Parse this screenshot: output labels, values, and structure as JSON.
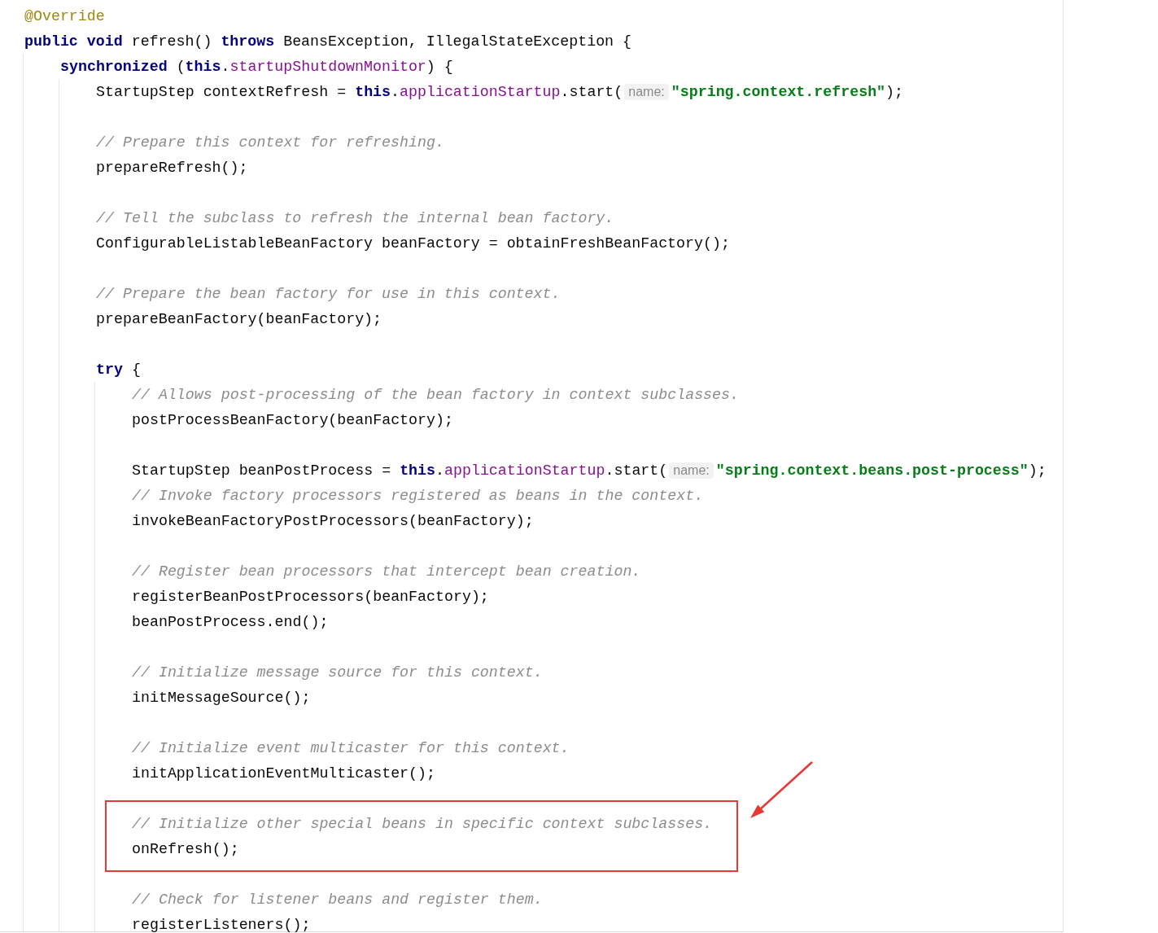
{
  "editor": {
    "lines": [
      {
        "kind": "code",
        "tokens": [
          {
            "kind": "annotation",
            "text": "@Override"
          }
        ]
      },
      {
        "kind": "code",
        "tokens": [
          {
            "kind": "keyword",
            "text": "public void"
          },
          {
            "kind": "plain",
            "text": " refresh() "
          },
          {
            "kind": "keyword",
            "text": "throws"
          },
          {
            "kind": "plain",
            "text": " BeansException, IllegalStateException {"
          }
        ],
        "children": [
          {
            "kind": "code",
            "tokens": [
              {
                "kind": "keyword",
                "text": "synchronized"
              },
              {
                "kind": "plain",
                "text": " ("
              },
              {
                "kind": "keyword",
                "text": "this"
              },
              {
                "kind": "plain",
                "text": "."
              },
              {
                "kind": "field",
                "text": "startupShutdownMonitor"
              },
              {
                "kind": "plain",
                "text": ") {"
              }
            ],
            "children": [
              {
                "kind": "code",
                "tokens": [
                  {
                    "kind": "plain",
                    "text": "StartupStep contextRefresh = "
                  },
                  {
                    "kind": "keyword",
                    "text": "this"
                  },
                  {
                    "kind": "plain",
                    "text": "."
                  },
                  {
                    "kind": "field",
                    "text": "applicationStartup"
                  },
                  {
                    "kind": "plain",
                    "text": ".start("
                  },
                  {
                    "kind": "hint",
                    "text": "name:"
                  },
                  {
                    "kind": "string",
                    "text": "\"spring.context.refresh\""
                  },
                  {
                    "kind": "plain",
                    "text": ");"
                  }
                ]
              },
              {
                "kind": "blank"
              },
              {
                "kind": "code",
                "tokens": [
                  {
                    "kind": "comment",
                    "text": "// Prepare this context for refreshing."
                  }
                ]
              },
              {
                "kind": "code",
                "tokens": [
                  {
                    "kind": "plain",
                    "text": "prepareRefresh();"
                  }
                ]
              },
              {
                "kind": "blank"
              },
              {
                "kind": "code",
                "tokens": [
                  {
                    "kind": "comment",
                    "text": "// Tell the subclass to refresh the internal bean factory."
                  }
                ]
              },
              {
                "kind": "code",
                "tokens": [
                  {
                    "kind": "plain",
                    "text": "ConfigurableListableBeanFactory beanFactory = obtainFreshBeanFactory();"
                  }
                ]
              },
              {
                "kind": "blank"
              },
              {
                "kind": "code",
                "tokens": [
                  {
                    "kind": "comment",
                    "text": "// Prepare the bean factory for use in this context."
                  }
                ]
              },
              {
                "kind": "code",
                "tokens": [
                  {
                    "kind": "plain",
                    "text": "prepareBeanFactory(beanFactory);"
                  }
                ]
              },
              {
                "kind": "blank"
              },
              {
                "kind": "code",
                "tokens": [
                  {
                    "kind": "keyword",
                    "text": "try"
                  },
                  {
                    "kind": "plain",
                    "text": " {"
                  }
                ],
                "children": [
                  {
                    "kind": "code",
                    "tokens": [
                      {
                        "kind": "comment",
                        "text": "// Allows post-processing of the bean factory in context subclasses."
                      }
                    ]
                  },
                  {
                    "kind": "code",
                    "tokens": [
                      {
                        "kind": "plain",
                        "text": "postProcessBeanFactory(beanFactory);"
                      }
                    ]
                  },
                  {
                    "kind": "blank"
                  },
                  {
                    "kind": "code",
                    "tokens": [
                      {
                        "kind": "plain",
                        "text": "StartupStep beanPostProcess = "
                      },
                      {
                        "kind": "keyword",
                        "text": "this"
                      },
                      {
                        "kind": "plain",
                        "text": "."
                      },
                      {
                        "kind": "field",
                        "text": "applicationStartup"
                      },
                      {
                        "kind": "plain",
                        "text": ".start("
                      },
                      {
                        "kind": "hint",
                        "text": "name:"
                      },
                      {
                        "kind": "string",
                        "text": "\"spring.context.beans.post-process\""
                      },
                      {
                        "kind": "plain",
                        "text": ");"
                      }
                    ]
                  },
                  {
                    "kind": "code",
                    "tokens": [
                      {
                        "kind": "comment",
                        "text": "// Invoke factory processors registered as beans in the context."
                      }
                    ]
                  },
                  {
                    "kind": "code",
                    "tokens": [
                      {
                        "kind": "plain",
                        "text": "invokeBeanFactoryPostProcessors(beanFactory);"
                      }
                    ]
                  },
                  {
                    "kind": "blank"
                  },
                  {
                    "kind": "code",
                    "tokens": [
                      {
                        "kind": "comment",
                        "text": "// Register bean processors that intercept bean creation."
                      }
                    ]
                  },
                  {
                    "kind": "code",
                    "tokens": [
                      {
                        "kind": "plain",
                        "text": "registerBeanPostProcessors(beanFactory);"
                      }
                    ]
                  },
                  {
                    "kind": "code",
                    "tokens": [
                      {
                        "kind": "plain",
                        "text": "beanPostProcess.end();"
                      }
                    ]
                  },
                  {
                    "kind": "blank"
                  },
                  {
                    "kind": "code",
                    "tokens": [
                      {
                        "kind": "comment",
                        "text": "// Initialize message source for this context."
                      }
                    ]
                  },
                  {
                    "kind": "code",
                    "tokens": [
                      {
                        "kind": "plain",
                        "text": "initMessageSource();"
                      }
                    ]
                  },
                  {
                    "kind": "blank"
                  },
                  {
                    "kind": "code",
                    "tokens": [
                      {
                        "kind": "comment",
                        "text": "// Initialize event multicaster for this context."
                      }
                    ]
                  },
                  {
                    "kind": "code",
                    "tokens": [
                      {
                        "kind": "plain",
                        "text": "initApplicationEventMulticaster();"
                      }
                    ]
                  },
                  {
                    "kind": "blank"
                  },
                  {
                    "kind": "code",
                    "highlighted": true,
                    "tokens": [
                      {
                        "kind": "comment",
                        "text": "// Initialize other special beans in specific context subclasses."
                      }
                    ]
                  },
                  {
                    "kind": "code",
                    "highlighted": true,
                    "tokens": [
                      {
                        "kind": "plain",
                        "text": "onRefresh();"
                      }
                    ]
                  },
                  {
                    "kind": "blank"
                  },
                  {
                    "kind": "code",
                    "tokens": [
                      {
                        "kind": "comment",
                        "text": "// Check for listener beans and register them."
                      }
                    ]
                  },
                  {
                    "kind": "code",
                    "tokens": [
                      {
                        "kind": "plain",
                        "text": "registerListeners();"
                      }
                    ]
                  }
                ]
              }
            ]
          }
        ]
      }
    ]
  }
}
